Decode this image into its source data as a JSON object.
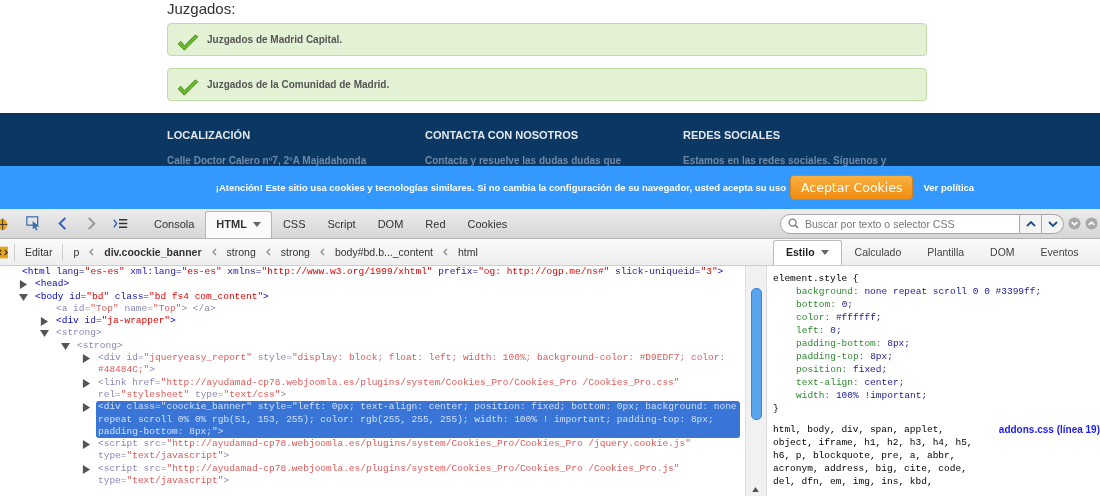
{
  "page": {
    "heading": "Juzgados:",
    "notices": [
      {
        "text": "Juzgados de Madrid Capital."
      },
      {
        "text": "Juzgados de la Comunidad de Madrid."
      }
    ]
  },
  "footer": {
    "columns": [
      {
        "heading": "LOCALIZACIÓN",
        "text": "Calle Doctor Calero nº7, 2ºA Majadahonda"
      },
      {
        "heading": "CONTACTA CON NOSOTROS",
        "text": "Contacta y resuelve las dudas dudas que"
      },
      {
        "heading": "REDES SOCIALES",
        "text": "Estamos en las redes sociales. Síguenos y"
      }
    ]
  },
  "cookie_banner": {
    "message": "¡Atención! Este sitio usa cookies y tecnologías similares. Si no cambia la configuración de su navegador, usted acepta su uso",
    "button": "Aceptar Cookies",
    "link": "Ver política"
  },
  "devtools": {
    "tabs": [
      {
        "label": "Consola",
        "selected": false,
        "menu": false
      },
      {
        "label": "HTML",
        "selected": true,
        "menu": true
      },
      {
        "label": "CSS",
        "selected": false,
        "menu": false
      },
      {
        "label": "Script",
        "selected": false,
        "menu": false
      },
      {
        "label": "DOM",
        "selected": false,
        "menu": false
      },
      {
        "label": "Red",
        "selected": false,
        "menu": false
      },
      {
        "label": "Cookies",
        "selected": false,
        "menu": false
      }
    ],
    "search": {
      "placeholder": "Buscar por texto o selector CSS"
    },
    "edit_button": "Editar",
    "breadcrumbs": [
      {
        "label": "p",
        "selected": false
      },
      {
        "label": "div.coockie_banner",
        "selected": true
      },
      {
        "label": "strong",
        "selected": false
      },
      {
        "label": "strong",
        "selected": false
      },
      {
        "label": "body#bd.b..._content",
        "selected": false
      },
      {
        "label": "html",
        "selected": false
      }
    ],
    "side_tabs": [
      {
        "label": "Estilo",
        "selected": true,
        "menu": true
      },
      {
        "label": "Calculado",
        "selected": false,
        "menu": false
      },
      {
        "label": "Plantilla",
        "selected": false,
        "menu": false
      },
      {
        "label": "DOM",
        "selected": false,
        "menu": false
      },
      {
        "label": "Eventos",
        "selected": false,
        "menu": false
      }
    ],
    "html_tree": [
      {
        "dim": false,
        "selected": false,
        "parts": [
          {
            "kind": "tag",
            "text": "<html"
          },
          {
            "kind": "attr",
            "text": " lang="
          },
          {
            "kind": "val",
            "text": "\"es-es\""
          },
          {
            "kind": "attr",
            "text": " xml:lang="
          },
          {
            "kind": "val",
            "text": "\"es-es\""
          },
          {
            "kind": "attr",
            "text": " xmlns="
          },
          {
            "kind": "val",
            "text": "\"http://www.w3.org/1999/xhtml\""
          },
          {
            "kind": "attr",
            "text": " prefix="
          },
          {
            "kind": "val",
            "text": "\"og: http://ogp.me/ns#\""
          },
          {
            "kind": "attr",
            "text": " slick-uniqueid="
          },
          {
            "kind": "val",
            "text": "\"3\""
          },
          {
            "kind": "tag",
            "text": ">"
          }
        ],
        "children": [
          {
            "dim": false,
            "selected": false,
            "expanded": false,
            "parts": [
              {
                "kind": "tag",
                "text": "<head>"
              }
            ]
          },
          {
            "dim": false,
            "selected": false,
            "expanded": true,
            "parts": [
              {
                "kind": "tag",
                "text": "<body"
              },
              {
                "kind": "attr",
                "text": " id="
              },
              {
                "kind": "val",
                "text": "\"bd\""
              },
              {
                "kind": "attr",
                "text": " class="
              },
              {
                "kind": "val",
                "text": "\"bd fs4 com_content\""
              },
              {
                "kind": "tag",
                "text": ">"
              }
            ],
            "children": [
              {
                "dim": true,
                "selected": false,
                "parts": [
                  {
                    "kind": "tag",
                    "text": "<a"
                  },
                  {
                    "kind": "attr",
                    "text": " id="
                  },
                  {
                    "kind": "val",
                    "text": "\"Top\""
                  },
                  {
                    "kind": "attr",
                    "text": " name="
                  },
                  {
                    "kind": "val",
                    "text": "\"Top\""
                  },
                  {
                    "kind": "tag",
                    "text": "> </a>"
                  }
                ]
              },
              {
                "dim": false,
                "selected": false,
                "expanded": false,
                "parts": [
                  {
                    "kind": "tag",
                    "text": "<div"
                  },
                  {
                    "kind": "attr",
                    "text": " id="
                  },
                  {
                    "kind": "val",
                    "text": "\"ja-wrapper\""
                  },
                  {
                    "kind": "tag",
                    "text": ">"
                  }
                ]
              },
              {
                "dim": true,
                "selected": false,
                "expanded": true,
                "parts": [
                  {
                    "kind": "tag",
                    "text": "<strong>"
                  }
                ],
                "children": [
                  {
                    "dim": true,
                    "selected": false,
                    "expanded": true,
                    "parts": [
                      {
                        "kind": "tag",
                        "text": "<strong>"
                      }
                    ],
                    "children": [
                      {
                        "dim": true,
                        "selected": false,
                        "expanded": false,
                        "parts": [
                          {
                            "kind": "tag",
                            "text": "<div"
                          },
                          {
                            "kind": "attr",
                            "text": " id="
                          },
                          {
                            "kind": "val",
                            "text": "\"jqueryeasy_report\""
                          },
                          {
                            "kind": "attr",
                            "text": " style="
                          },
                          {
                            "kind": "val",
                            "text": "\"display: block; float: left; width: 100%; background-color: #D9EDF7; color: #48484C;\""
                          },
                          {
                            "kind": "tag",
                            "text": ">"
                          }
                        ]
                      },
                      {
                        "dim": true,
                        "selected": false,
                        "expanded": false,
                        "parts": [
                          {
                            "kind": "tag",
                            "text": "<link"
                          },
                          {
                            "kind": "attr",
                            "text": " href="
                          },
                          {
                            "kind": "val",
                            "text": "\"http://ayudamad-cp78.webjoomla.es/plugins/system/Cookies_Pro/Cookies_Pro /Cookies_Pro.css\""
                          },
                          {
                            "kind": "attr",
                            "text": " rel="
                          },
                          {
                            "kind": "val",
                            "text": "\"stylesheet\""
                          },
                          {
                            "kind": "attr",
                            "text": " type="
                          },
                          {
                            "kind": "val",
                            "text": "\"text/css\""
                          },
                          {
                            "kind": "tag",
                            "text": ">"
                          }
                        ]
                      },
                      {
                        "dim": true,
                        "selected": true,
                        "expanded": false,
                        "parts": [
                          {
                            "kind": "tag",
                            "text": "<div"
                          },
                          {
                            "kind": "attr",
                            "text": " class="
                          },
                          {
                            "kind": "val",
                            "text": "\"coockie_banner\""
                          },
                          {
                            "kind": "attr",
                            "text": " style="
                          },
                          {
                            "kind": "val",
                            "text": "\"left: 0px; text-align: center; position: fixed; bottom: 0px; background: none repeat scroll 0% 0% rgb(51, 153, 255); color: rgb(255, 255, 255); width: 100% ! important; padding-top: 8px; padding-bottom: 8px;\""
                          },
                          {
                            "kind": "tag",
                            "text": ">"
                          }
                        ]
                      },
                      {
                        "dim": true,
                        "selected": false,
                        "expanded": false,
                        "parts": [
                          {
                            "kind": "tag",
                            "text": "<script"
                          },
                          {
                            "kind": "attr",
                            "text": " src="
                          },
                          {
                            "kind": "val",
                            "text": "\"http://ayudamad-cp78.webjoomla.es/plugins/system/Cookies_Pro/Cookies_Pro /jquery.cookie.js\""
                          },
                          {
                            "kind": "attr",
                            "text": " type="
                          },
                          {
                            "kind": "val",
                            "text": "\"text/javascript\""
                          },
                          {
                            "kind": "tag",
                            "text": ">"
                          }
                        ]
                      },
                      {
                        "dim": true,
                        "selected": false,
                        "expanded": false,
                        "parts": [
                          {
                            "kind": "tag",
                            "text": "<script"
                          },
                          {
                            "kind": "attr",
                            "text": " src="
                          },
                          {
                            "kind": "val",
                            "text": "\"http://ayudamad-cp78.webjoomla.es/plugins/system/Cookies_Pro/Cookies_Pro /Cookies_Pro.js\""
                          },
                          {
                            "kind": "attr",
                            "text": " type="
                          },
                          {
                            "kind": "val",
                            "text": "\"text/javascript\""
                          },
                          {
                            "kind": "tag",
                            "text": ">"
                          }
                        ]
                      }
                    ]
                  }
                ]
              }
            ]
          }
        ]
      }
    ],
    "style_rules": [
      {
        "selector": "element.style {",
        "properties": [
          {
            "name": "background:",
            "value": "none repeat scroll 0 0 #3399ff;"
          },
          {
            "name": "bottom:",
            "value": "0;"
          },
          {
            "name": "color:",
            "value": "#ffffff;"
          },
          {
            "name": "left:",
            "value": "0;"
          },
          {
            "name": "padding-bottom:",
            "value": "8px;"
          },
          {
            "name": "padding-top:",
            "value": "8px;"
          },
          {
            "name": "position:",
            "value": "fixed;"
          },
          {
            "name": "text-align:",
            "value": "center;"
          },
          {
            "name": "width:",
            "value": "100% !important;"
          }
        ],
        "close": "}"
      },
      {
        "selector": "html, body, div, span, applet, object, iframe, h1, h2, h3, h4, h5, h6, p, blockquote, pre, a, abbr, acronym, address, big, cite, code, del, dfn, em, img, ins, kbd,",
        "source": "addons.css (línea 19)"
      }
    ]
  }
}
